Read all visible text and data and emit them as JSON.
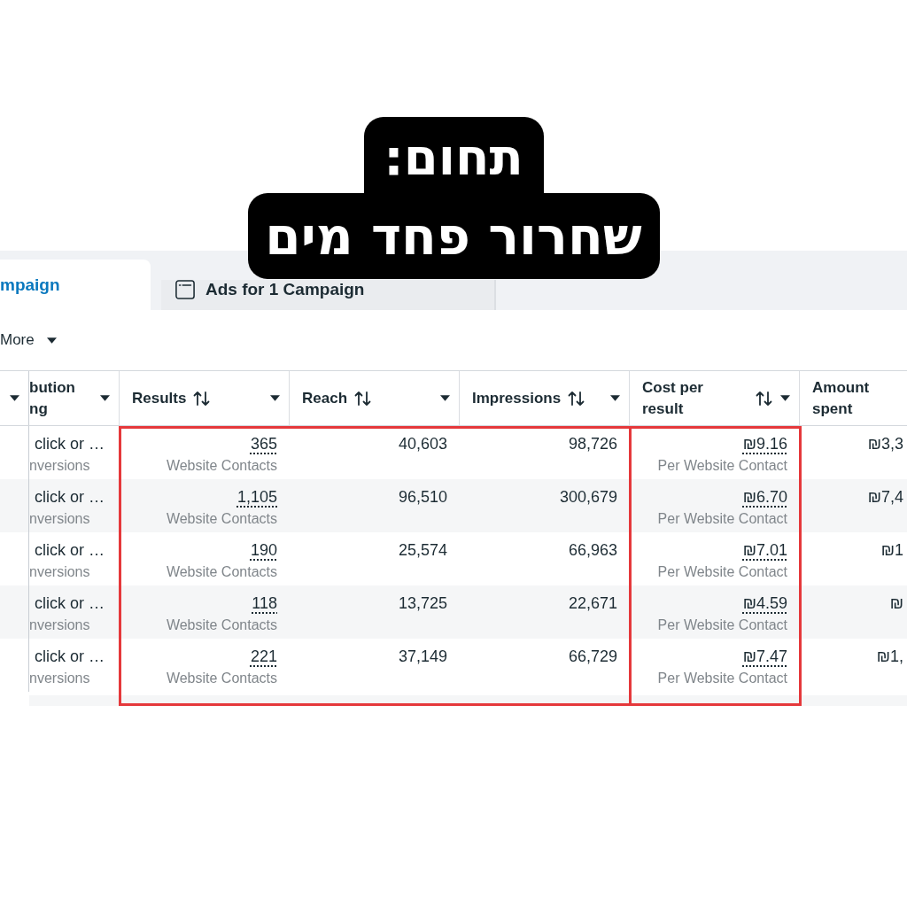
{
  "topic_label": {
    "heading": "תחום:",
    "title": "שחרור פחד מים"
  },
  "tabs": [
    {
      "label": "mpaign",
      "selected": true,
      "icon": false
    },
    {
      "label": "Ads for 1 Campaign",
      "selected": false,
      "icon": true
    }
  ],
  "toolbar": {
    "more_button": "More"
  },
  "table": {
    "leading_column": {
      "menu": true
    },
    "column_groups": [
      {
        "framed": false,
        "columns": [
          {
            "kind": "text",
            "lines": [
              "bution",
              "ng"
            ],
            "sortable": false,
            "menu": true
          }
        ]
      },
      {
        "framed": true,
        "columns": [
          {
            "kind": "metric",
            "lines": [
              "Results"
            ],
            "sortable": true,
            "menu": true
          },
          {
            "kind": "number",
            "lines": [
              "Reach"
            ],
            "sortable": true,
            "menu": true
          },
          {
            "kind": "number",
            "lines": [
              "Impressions"
            ],
            "sortable": true,
            "menu": true
          }
        ]
      },
      {
        "framed": true,
        "columns": [
          {
            "kind": "metric",
            "lines": [
              "Cost per",
              "result"
            ],
            "sortable": true,
            "menu": true
          }
        ]
      },
      {
        "framed": false,
        "columns": [
          {
            "kind": "number",
            "lines": [
              "Amount",
              "spent"
            ],
            "sortable": false,
            "menu": false
          }
        ]
      }
    ],
    "rows": [
      {
        "cells": [
          {
            "value": "click or …",
            "caption": "nversions"
          },
          {
            "value": "365",
            "caption": "Website Contacts"
          },
          {
            "value": "40,603"
          },
          {
            "value": "98,726"
          },
          {
            "value": "₪9.16",
            "caption": "Per Website Contact"
          },
          {
            "value": "₪3,3"
          }
        ]
      },
      {
        "cells": [
          {
            "value": "click or …",
            "caption": "nversions"
          },
          {
            "value": "1,105",
            "caption": "Website Contacts"
          },
          {
            "value": "96,510"
          },
          {
            "value": "300,679"
          },
          {
            "value": "₪6.70",
            "caption": "Per Website Contact"
          },
          {
            "value": "₪7,4"
          }
        ]
      },
      {
        "cells": [
          {
            "value": "click or …",
            "caption": "nversions"
          },
          {
            "value": "190",
            "caption": "Website Contacts"
          },
          {
            "value": "25,574"
          },
          {
            "value": "66,963"
          },
          {
            "value": "₪7.01",
            "caption": "Per Website Contact"
          },
          {
            "value": "₪1"
          }
        ]
      },
      {
        "cells": [
          {
            "value": "click or …",
            "caption": "nversions"
          },
          {
            "value": "118",
            "caption": "Website Contacts"
          },
          {
            "value": "13,725"
          },
          {
            "value": "22,671"
          },
          {
            "value": "₪4.59",
            "caption": "Per Website Contact"
          },
          {
            "value": "₪"
          }
        ]
      },
      {
        "cells": [
          {
            "value": "click or …",
            "caption": "nversions"
          },
          {
            "value": "221",
            "caption": "Website Contacts"
          },
          {
            "value": "37,149"
          },
          {
            "value": "66,729"
          },
          {
            "value": "₪7.47",
            "caption": "Per Website Contact"
          },
          {
            "value": "₪1,"
          }
        ]
      }
    ]
  }
}
